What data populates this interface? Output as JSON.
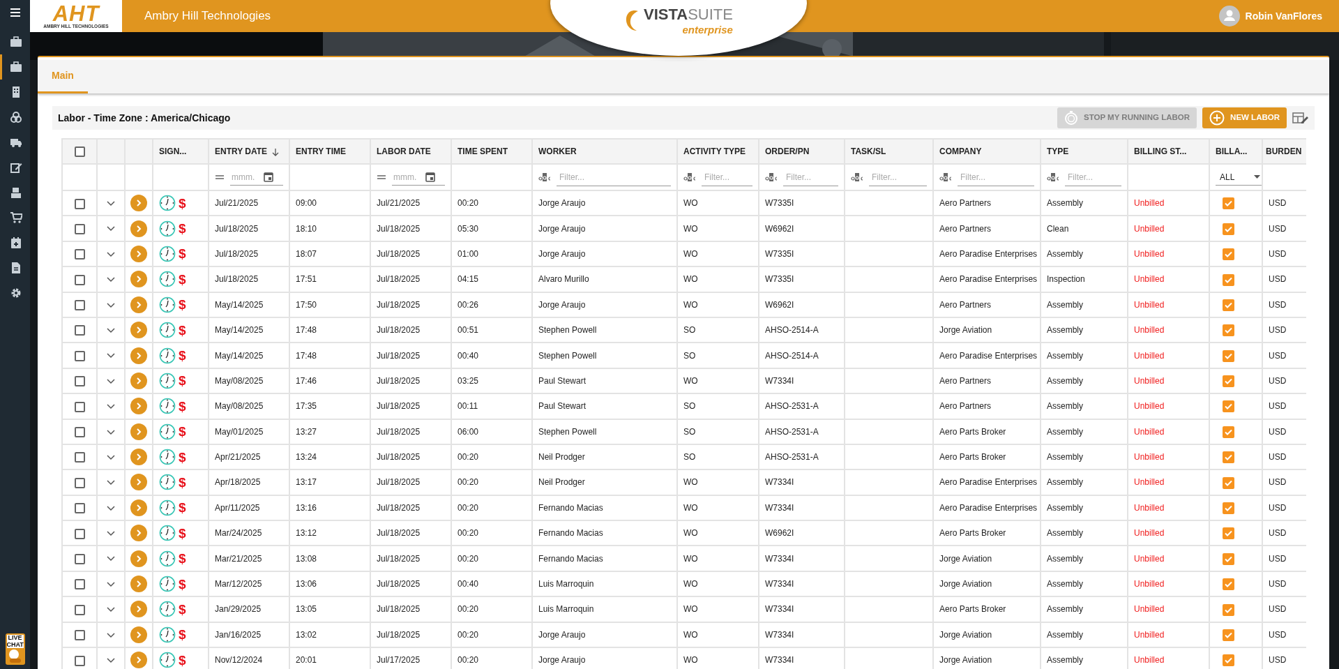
{
  "header": {
    "logo_letters": "AHT",
    "logo_caption": "AMBRY HILL TECHNOLOGIES",
    "company": "Ambry Hill Technologies",
    "product_logo": {
      "word1": "VISTA",
      "word2": "SUITE",
      "tagline": "enterprise"
    },
    "user": "Robin VanFlores"
  },
  "sidebar": {
    "items": [
      {
        "selected": false
      },
      {
        "selected": true
      },
      {
        "selected": false
      },
      {
        "selected": false
      },
      {
        "selected": false
      },
      {
        "selected": false
      },
      {
        "selected": false
      },
      {
        "selected": false
      },
      {
        "selected": false
      },
      {
        "selected": false
      },
      {
        "selected": false
      }
    ],
    "live_chat": "LIVE CHAT"
  },
  "tabs": [
    {
      "label": "Main",
      "selected": true
    }
  ],
  "section": {
    "title": "Labor - Time Zone : America/Chicago",
    "buttons": [
      {
        "label": "STOP MY RUNNING LABOR",
        "kind": "stop",
        "disabled": true
      },
      {
        "label": "NEW LABOR",
        "kind": "new",
        "disabled": false
      }
    ]
  },
  "table": {
    "all_selected": false,
    "columns": [
      {
        "kind": "select"
      },
      {
        "kind": "expand"
      },
      {
        "kind": "open"
      },
      {
        "label": "SIGN...",
        "kind": "signs"
      },
      {
        "label": "ENTRY DATE",
        "sort_descending": true,
        "filter": {
          "kind": "date",
          "placeholder": "mmm."
        }
      },
      {
        "label": "ENTRY TIME"
      },
      {
        "label": "LABOR DATE",
        "filter": {
          "kind": "date",
          "placeholder": "mmm."
        }
      },
      {
        "label": "TIME SPENT"
      },
      {
        "label": "WORKER",
        "filter": {
          "kind": "text",
          "placeholder": "Filter..."
        }
      },
      {
        "label": "ACTIVITY TYPE",
        "filter": {
          "kind": "text",
          "placeholder": "Filter..."
        }
      },
      {
        "label": "ORDER/PN",
        "filter": {
          "kind": "text",
          "placeholder": "Filter..."
        }
      },
      {
        "label": "TASK/SL",
        "filter": {
          "kind": "text",
          "placeholder": "Filter..."
        }
      },
      {
        "label": "COMPANY",
        "filter": {
          "kind": "text",
          "placeholder": "Filter..."
        }
      },
      {
        "label": "TYPE",
        "filter": {
          "kind": "text",
          "placeholder": "Filter..."
        }
      },
      {
        "label": "BILLING ST..."
      },
      {
        "label": "BILLA...",
        "filter": {
          "kind": "select",
          "value": "ALL"
        }
      },
      {
        "label": "BURDEN"
      }
    ],
    "rows": [
      {
        "selected": false,
        "dollar": "$",
        "entry_date": "Jul/21/2025",
        "entry_time": "09:00",
        "labor_date": "Jul/21/2025",
        "time_spent": "00:20",
        "worker": "Jorge Araujo",
        "activity": "WO",
        "order": "W7335I",
        "company": "Aero Partners",
        "type": "Assembly",
        "billing": "Unbilled",
        "billable": true,
        "burden": "USD"
      },
      {
        "selected": false,
        "dollar": "$",
        "entry_date": "Jul/18/2025",
        "entry_time": "18:10",
        "labor_date": "Jul/18/2025",
        "time_spent": "05:30",
        "worker": "Jorge Araujo",
        "activity": "WO",
        "order": "W6962I",
        "company": "Aero Partners",
        "type": "Clean",
        "billing": "Unbilled",
        "billable": true,
        "burden": "USD"
      },
      {
        "selected": false,
        "dollar": "$",
        "entry_date": "Jul/18/2025",
        "entry_time": "18:07",
        "labor_date": "Jul/18/2025",
        "time_spent": "01:00",
        "worker": "Jorge Araujo",
        "activity": "WO",
        "order": "W7335I",
        "company": "Aero Paradise Enterprises",
        "type": "Assembly",
        "billing": "Unbilled",
        "billable": true,
        "burden": "USD"
      },
      {
        "selected": false,
        "dollar": "$",
        "entry_date": "Jul/18/2025",
        "entry_time": "17:51",
        "labor_date": "Jul/18/2025",
        "time_spent": "04:15",
        "worker": "Alvaro Murillo",
        "activity": "WO",
        "order": "W7335I",
        "company": "Aero Paradise Enterprises",
        "type": "Inspection",
        "billing": "Unbilled",
        "billable": true,
        "burden": "USD"
      },
      {
        "selected": false,
        "dollar": "$",
        "entry_date": "May/14/2025",
        "entry_time": "17:50",
        "labor_date": "Jul/18/2025",
        "time_spent": "00:26",
        "worker": "Jorge Araujo",
        "activity": "WO",
        "order": "W6962I",
        "company": "Aero Partners",
        "type": "Assembly",
        "billing": "Unbilled",
        "billable": true,
        "burden": "USD"
      },
      {
        "selected": false,
        "dollar": "$",
        "entry_date": "May/14/2025",
        "entry_time": "17:48",
        "labor_date": "Jul/18/2025",
        "time_spent": "00:51",
        "worker": "Stephen Powell",
        "activity": "SO",
        "order": "AHSO-2514-A",
        "company": "Jorge Aviation",
        "type": "Assembly",
        "billing": "Unbilled",
        "billable": true,
        "burden": "USD"
      },
      {
        "selected": false,
        "dollar": "$",
        "entry_date": "May/14/2025",
        "entry_time": "17:48",
        "labor_date": "Jul/18/2025",
        "time_spent": "00:40",
        "worker": "Stephen Powell",
        "activity": "SO",
        "order": "AHSO-2514-A",
        "company": "Aero Paradise Enterprises",
        "type": "Assembly",
        "billing": "Unbilled",
        "billable": true,
        "burden": "USD"
      },
      {
        "selected": false,
        "dollar": "$",
        "entry_date": "May/08/2025",
        "entry_time": "17:46",
        "labor_date": "Jul/18/2025",
        "time_spent": "03:25",
        "worker": "Paul Stewart",
        "activity": "WO",
        "order": "W7334I",
        "company": "Aero Partners",
        "type": "Assembly",
        "billing": "Unbilled",
        "billable": true,
        "burden": "USD"
      },
      {
        "selected": false,
        "dollar": "$",
        "entry_date": "May/08/2025",
        "entry_time": "17:35",
        "labor_date": "Jul/18/2025",
        "time_spent": "00:11",
        "worker": "Paul Stewart",
        "activity": "SO",
        "order": "AHSO-2531-A",
        "company": "Aero Partners",
        "type": "Assembly",
        "billing": "Unbilled",
        "billable": true,
        "burden": "USD"
      },
      {
        "selected": false,
        "dollar": "$",
        "entry_date": "May/01/2025",
        "entry_time": "13:27",
        "labor_date": "Jul/18/2025",
        "time_spent": "06:00",
        "worker": "Stephen Powell",
        "activity": "SO",
        "order": "AHSO-2531-A",
        "company": "Aero Parts Broker",
        "type": "Assembly",
        "billing": "Unbilled",
        "billable": true,
        "burden": "USD"
      },
      {
        "selected": false,
        "dollar": "$",
        "entry_date": "Apr/21/2025",
        "entry_time": "13:24",
        "labor_date": "Jul/18/2025",
        "time_spent": "00:20",
        "worker": "Neil Prodger",
        "activity": "SO",
        "order": "AHSO-2531-A",
        "company": "Aero Parts Broker",
        "type": "Assembly",
        "billing": "Unbilled",
        "billable": true,
        "burden": "USD"
      },
      {
        "selected": false,
        "dollar": "$",
        "entry_date": "Apr/18/2025",
        "entry_time": "13:17",
        "labor_date": "Jul/18/2025",
        "time_spent": "00:20",
        "worker": "Neil Prodger",
        "activity": "WO",
        "order": "W7334I",
        "company": "Aero Paradise Enterprises",
        "type": "Assembly",
        "billing": "Unbilled",
        "billable": true,
        "burden": "USD"
      },
      {
        "selected": false,
        "dollar": "$",
        "entry_date": "Apr/11/2025",
        "entry_time": "13:16",
        "labor_date": "Jul/18/2025",
        "time_spent": "00:20",
        "worker": "Fernando Macias",
        "activity": "WO",
        "order": "W7334I",
        "company": "Aero Paradise Enterprises",
        "type": "Assembly",
        "billing": "Unbilled",
        "billable": true,
        "burden": "USD"
      },
      {
        "selected": false,
        "dollar": "$",
        "entry_date": "Mar/24/2025",
        "entry_time": "13:12",
        "labor_date": "Jul/18/2025",
        "time_spent": "00:20",
        "worker": "Fernando Macias",
        "activity": "WO",
        "order": "W6962I",
        "company": "Aero Parts Broker",
        "type": "Assembly",
        "billing": "Unbilled",
        "billable": true,
        "burden": "USD"
      },
      {
        "selected": false,
        "dollar": "$",
        "entry_date": "Mar/21/2025",
        "entry_time": "13:08",
        "labor_date": "Jul/18/2025",
        "time_spent": "00:20",
        "worker": "Fernando Macias",
        "activity": "WO",
        "order": "W7334I",
        "company": "Jorge Aviation",
        "type": "Assembly",
        "billing": "Unbilled",
        "billable": true,
        "burden": "USD"
      },
      {
        "selected": false,
        "dollar": "$",
        "entry_date": "Mar/12/2025",
        "entry_time": "13:06",
        "labor_date": "Jul/18/2025",
        "time_spent": "00:40",
        "worker": "Luis Marroquin",
        "activity": "WO",
        "order": "W7334I",
        "company": "Jorge Aviation",
        "type": "Assembly",
        "billing": "Unbilled",
        "billable": true,
        "burden": "USD"
      },
      {
        "selected": false,
        "dollar": "$",
        "entry_date": "Jan/29/2025",
        "entry_time": "13:05",
        "labor_date": "Jul/18/2025",
        "time_spent": "00:20",
        "worker": "Luis Marroquin",
        "activity": "WO",
        "order": "W7334I",
        "company": "Aero Parts Broker",
        "type": "Assembly",
        "billing": "Unbilled",
        "billable": true,
        "burden": "USD"
      },
      {
        "selected": false,
        "dollar": "$",
        "entry_date": "Jan/16/2025",
        "entry_time": "13:02",
        "labor_date": "Jul/18/2025",
        "time_spent": "00:20",
        "worker": "Jorge Araujo",
        "activity": "WO",
        "order": "W7334I",
        "company": "Jorge Aviation",
        "type": "Assembly",
        "billing": "Unbilled",
        "billable": true,
        "burden": "USD"
      },
      {
        "selected": false,
        "dollar": "$",
        "entry_date": "Nov/12/2024",
        "entry_time": "20:01",
        "labor_date": "Jul/17/2025",
        "time_spent": "00:20",
        "worker": "Jorge Araujo",
        "activity": "WO",
        "order": "W7334I",
        "company": "Jorge Aviation",
        "type": "Assembly",
        "billing": "Unbilled",
        "billable": true,
        "burden": "USD"
      }
    ]
  }
}
